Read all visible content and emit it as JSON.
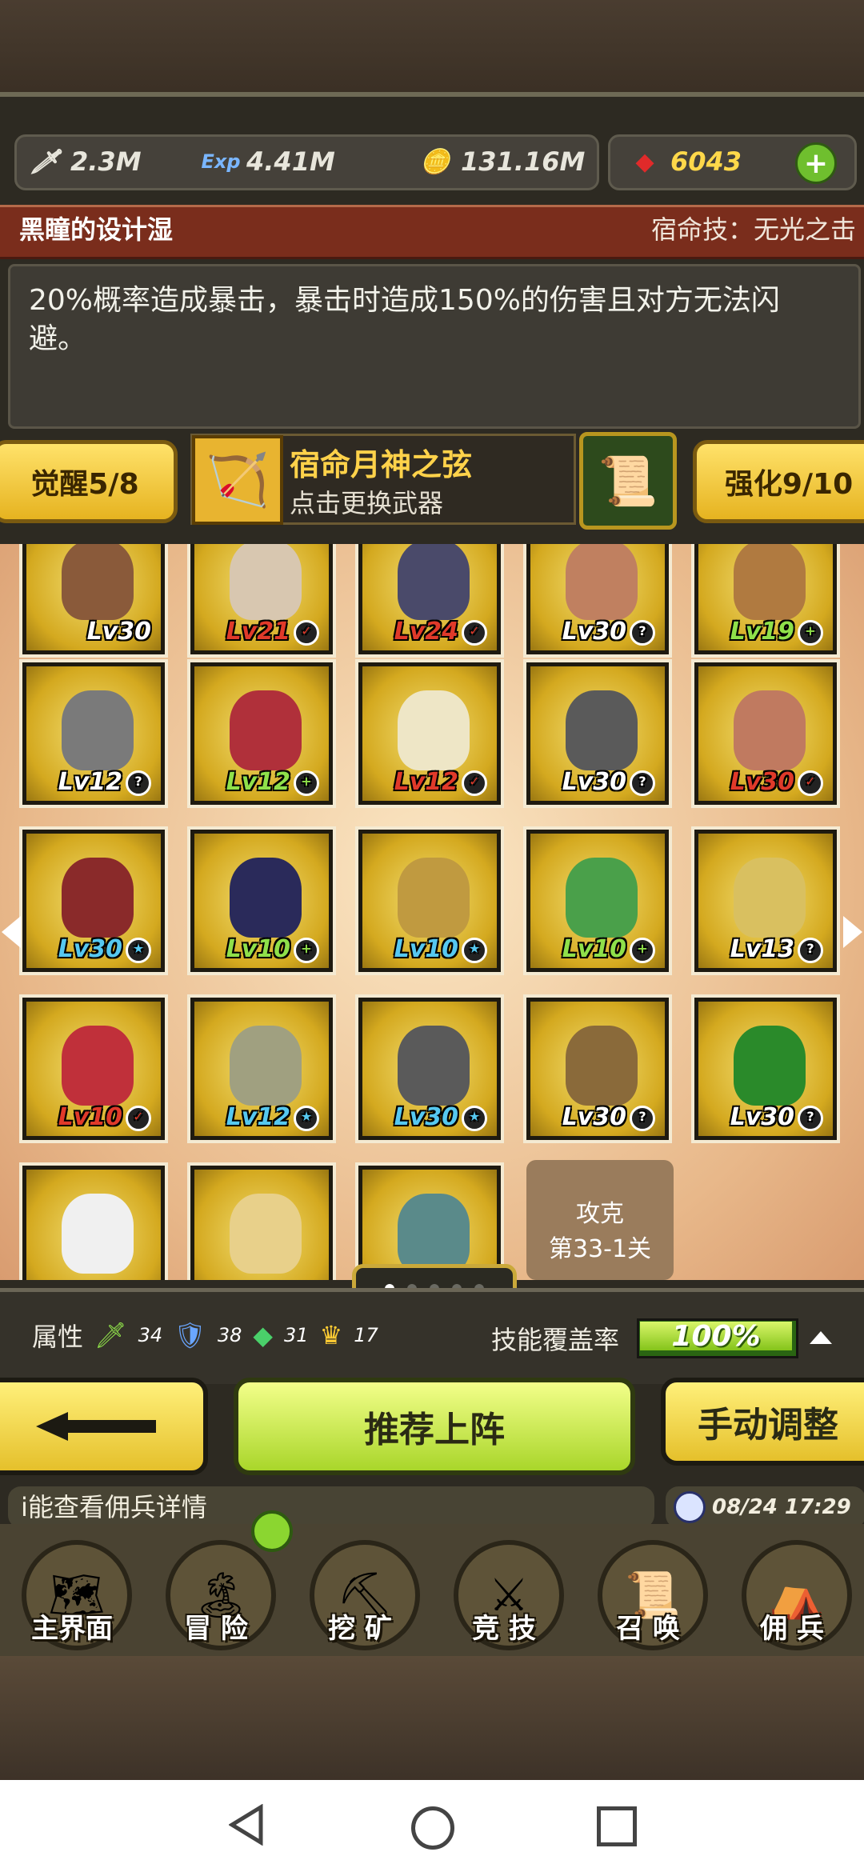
{
  "resources": {
    "attack": "2.3M",
    "exp": "4.41M",
    "gold": "131.16M",
    "gems": "6043"
  },
  "hero": {
    "name": "黑瞳的设计湿",
    "fate_skill": "宿命技：无光之击",
    "description": "20%概率造成暴击，暴击时造成150%的伤害且对方无法闪避。"
  },
  "weapon_row": {
    "awaken": "觉醒5/8",
    "weapon_name": "宿命月神之弦",
    "weapon_hint": "点击更换武器",
    "enhance": "强化9/10"
  },
  "mercenaries": [
    {
      "level": "Lv30",
      "badge": "",
      "color": "#ffffff"
    },
    {
      "level": "Lv21",
      "badge": "✓",
      "color": "#e03a2a"
    },
    {
      "level": "Lv24",
      "badge": "✓",
      "color": "#e03a2a"
    },
    {
      "level": "Lv30",
      "badge": "?",
      "color": "#ffffff"
    },
    {
      "level": "Lv19",
      "badge": "+",
      "color": "#8fe04a"
    },
    {
      "level": "Lv12",
      "badge": "?",
      "color": "#ffffff"
    },
    {
      "level": "Lv12",
      "badge": "+",
      "color": "#8fe04a"
    },
    {
      "level": "Lv12",
      "badge": "✓",
      "color": "#e03a2a"
    },
    {
      "level": "Lv30",
      "badge": "?",
      "color": "#ffffff"
    },
    {
      "level": "Lv30",
      "badge": "✓",
      "color": "#e03a2a"
    },
    {
      "level": "Lv30",
      "badge": "★",
      "color": "#56c8f0"
    },
    {
      "level": "Lv10",
      "badge": "+",
      "color": "#8fe04a"
    },
    {
      "level": "Lv10",
      "badge": "★",
      "color": "#56c8f0"
    },
    {
      "level": "Lv10",
      "badge": "+",
      "color": "#8fe04a"
    },
    {
      "level": "Lv13",
      "badge": "?",
      "color": "#ffffff"
    },
    {
      "level": "Lv10",
      "badge": "✓",
      "color": "#e03a2a"
    },
    {
      "level": "Lv12",
      "badge": "★",
      "color": "#56c8f0"
    },
    {
      "level": "Lv30",
      "badge": "★",
      "color": "#56c8f0"
    },
    {
      "level": "Lv30",
      "badge": "?",
      "color": "#ffffff"
    },
    {
      "level": "Lv30",
      "badge": "?",
      "color": "#ffffff"
    },
    {
      "level": "",
      "badge": "",
      "color": "#ffffff"
    },
    {
      "level": "",
      "badge": "",
      "color": "#ffffff"
    },
    {
      "level": "",
      "badge": "",
      "color": "#ffffff"
    }
  ],
  "conquer": {
    "line1": "攻克",
    "line2": "第33-1关"
  },
  "stats": {
    "label": "属性",
    "sword": "34",
    "shield": "38",
    "gem": "31",
    "crown": "17",
    "coverage_label": "技能覆盖率",
    "coverage_value": "100%",
    "coverage_fraction": 1.0
  },
  "buttons": {
    "recommend": "推荐上阵",
    "manual": "手动调整"
  },
  "ticker": {
    "text": "i能查看佣兵详情",
    "datetime": "08/24 17:29"
  },
  "nav": [
    {
      "label": "主界面",
      "icon": "map-scroll-icon",
      "glyph": "🗺"
    },
    {
      "label": "冒 险",
      "icon": "island-icon",
      "glyph": "🏝"
    },
    {
      "label": "挖 矿",
      "icon": "pickaxe-icon",
      "glyph": "⛏"
    },
    {
      "label": "竞 技",
      "icon": "crossed-swords-icon",
      "glyph": "⚔"
    },
    {
      "label": "召 唤",
      "icon": "summon-scroll-icon",
      "glyph": "📜"
    },
    {
      "label": "佣 兵",
      "icon": "tent-icon",
      "glyph": "⛺"
    }
  ]
}
